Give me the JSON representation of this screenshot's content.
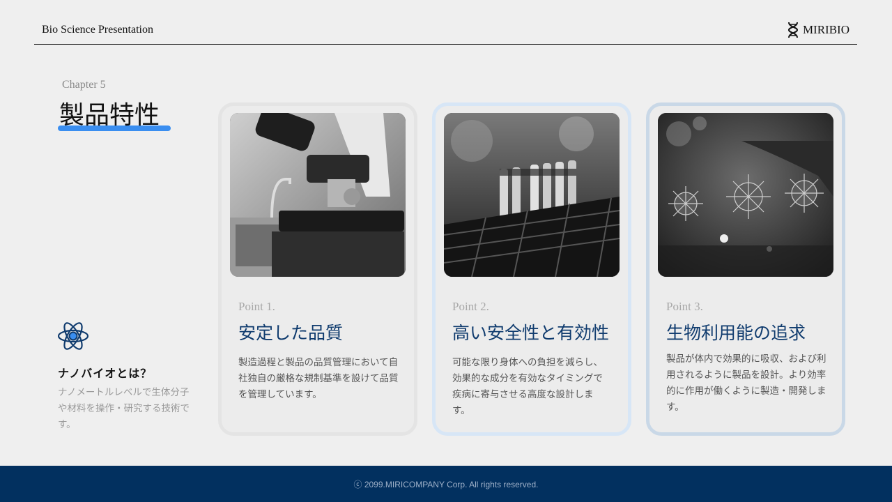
{
  "header": {
    "title": "Bio Science Presentation",
    "brand": "MIRIBIO",
    "brand_icon": "dna-icon"
  },
  "intro": {
    "chapter": "Chapter 5",
    "title": "製品特性",
    "accent_color": "#3a8ef0",
    "icon": "atom-icon",
    "heading": "ナノバイオとは？",
    "text": "ナノメートルレベルで生体分子や材料を操作・研究する技術です。"
  },
  "cards": [
    {
      "point": "Point 1.",
      "title": "安定した品質",
      "text": "製造過程と製品の品質管理において自社独自の厳格な規制基準を設けて品質を管理しています。",
      "image": "microscope-photo"
    },
    {
      "point": "Point 2.",
      "title": "高い安全性と有効性",
      "text": "可能な限り身体への負担を減らし、効果的な成分を有効なタイミングで疾病に寄与させる高度な設計します。",
      "image": "test-tubes-photo"
    },
    {
      "point": "Point 3.",
      "title": "生物利用能の追求",
      "text": "製品が体内で効果的に吸収、および利用されるように製品を設計。より効率的に作用が働くように製造・開発します。",
      "image": "virus-particles-photo"
    }
  ],
  "footer": {
    "copyright": "ⓒ 2099.MIRICOMPANY Corp. All rights reserved.",
    "background": "#02305f"
  }
}
